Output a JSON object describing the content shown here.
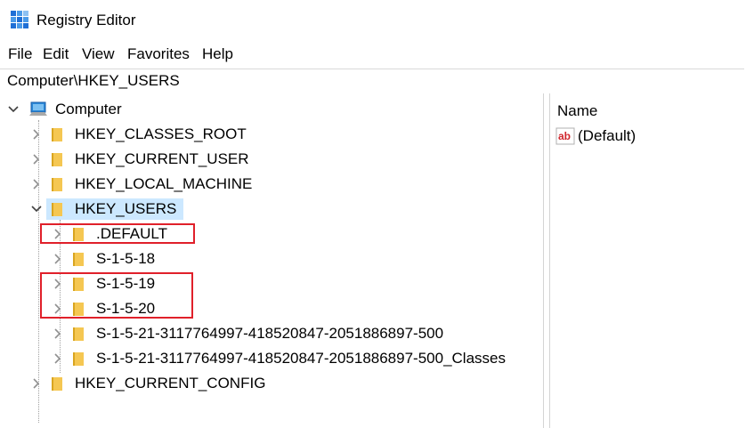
{
  "window": {
    "title": "Registry Editor"
  },
  "menu": [
    "File",
    "Edit",
    "View",
    "Favorites",
    "Help"
  ],
  "address": "Computer\\HKEY_USERS",
  "tree": {
    "root": "Computer",
    "hives": [
      "HKEY_CLASSES_ROOT",
      "HKEY_CURRENT_USER",
      "HKEY_LOCAL_MACHINE",
      "HKEY_USERS",
      "HKEY_CURRENT_CONFIG"
    ],
    "users": [
      ".DEFAULT",
      "S-1-5-18",
      "S-1-5-19",
      "S-1-5-20",
      "S-1-5-21-3117764997-418520847-2051886897-500",
      "S-1-5-21-3117764997-418520847-2051886897-500_Classes"
    ]
  },
  "values_pane": {
    "column_header": "Name",
    "rows": [
      "(Default)"
    ]
  },
  "colors": {
    "selection": "#cce8ff",
    "highlight_box": "#e0202a",
    "folder": "#f5c752"
  },
  "highlighted_keys": [
    ".DEFAULT",
    "S-1-5-19",
    "S-1-5-20"
  ]
}
